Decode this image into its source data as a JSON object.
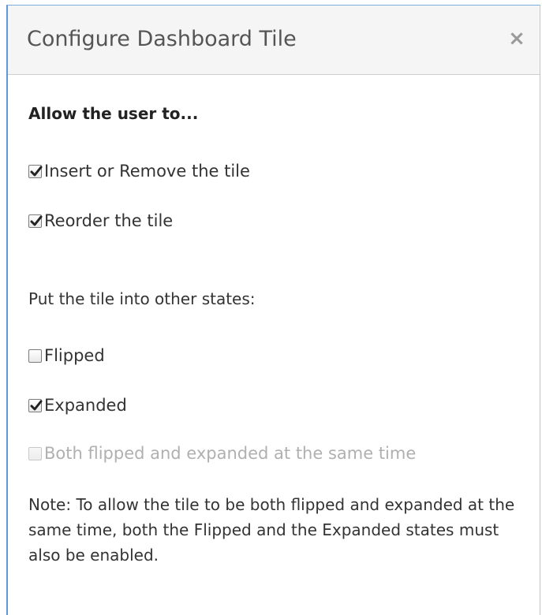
{
  "dialog": {
    "title": "Configure Dashboard Tile",
    "close_label": "×"
  },
  "permissions": {
    "heading": "Allow the user to...",
    "items": [
      {
        "label": "Insert or Remove the tile",
        "checked": true
      },
      {
        "label": "Reorder the tile",
        "checked": true
      }
    ]
  },
  "states": {
    "heading": "Put the tile into other states:",
    "items": [
      {
        "label": "Flipped",
        "checked": false,
        "disabled": false
      },
      {
        "label": "Expanded",
        "checked": true,
        "disabled": false
      },
      {
        "label": "Both flipped and expanded at the same time",
        "checked": false,
        "disabled": true
      }
    ]
  },
  "note": "Note: To allow the tile to be both flipped and expanded at the same time, both the Flipped and the Expanded states must also be enabled."
}
